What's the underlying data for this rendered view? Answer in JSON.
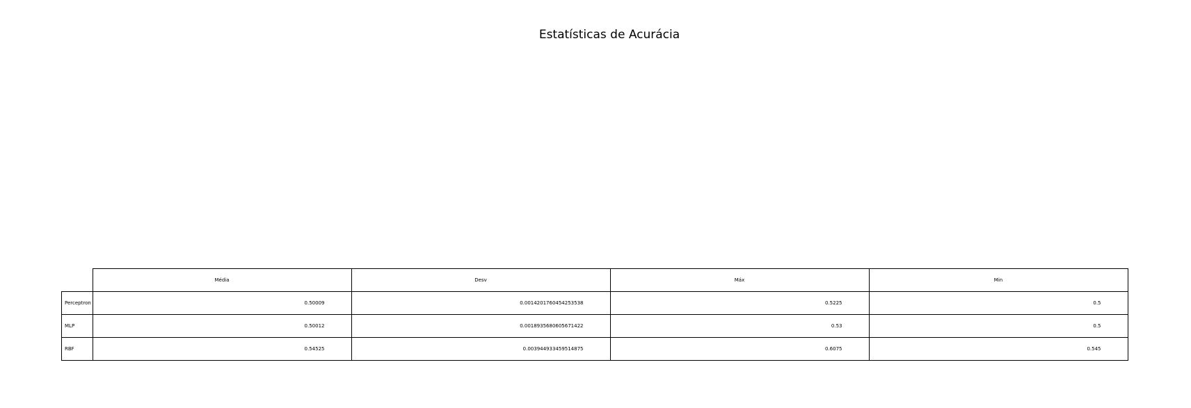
{
  "chart_data": {
    "type": "table",
    "title": "Estatísticas de Acurácia",
    "columns": [
      "Média",
      "Desv",
      "Máx",
      "Min"
    ],
    "rows": [
      {
        "label": "Perceptron",
        "values": [
          "0.50009",
          "0.0014201760454253538",
          "0.5225",
          "0.5"
        ]
      },
      {
        "label": "MLP",
        "values": [
          "0.50012",
          "0.0018935680605671422",
          "0.53",
          "0.5"
        ]
      },
      {
        "label": "RBF",
        "values": [
          "0.54525",
          "0.003944933459514875",
          "0.6075",
          "0.545"
        ]
      }
    ]
  }
}
